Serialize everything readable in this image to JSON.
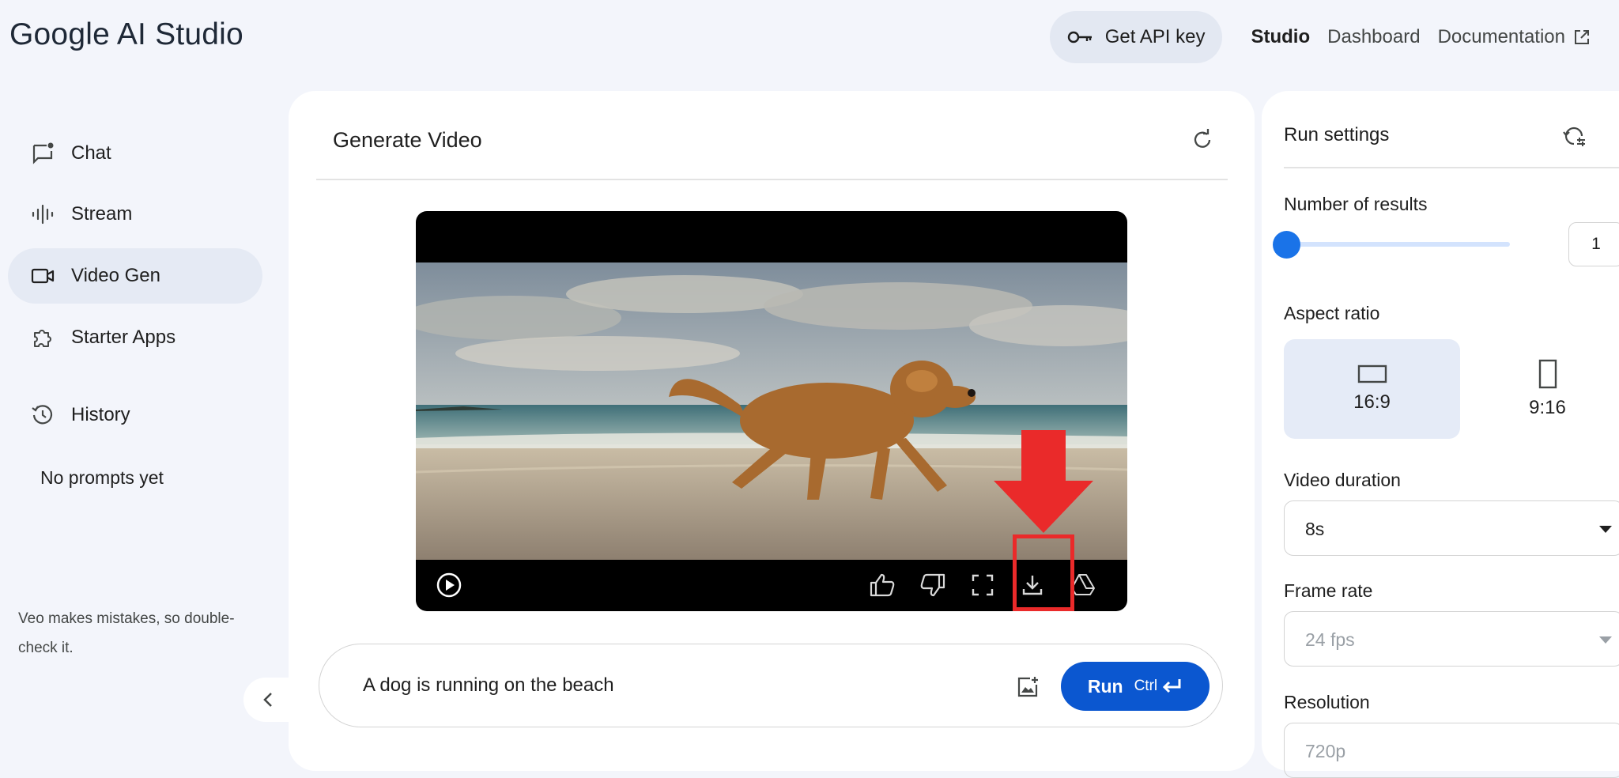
{
  "app": {
    "title": "Google AI Studio"
  },
  "header": {
    "api_key_label": "Get API key",
    "nav": {
      "studio": "Studio",
      "dashboard": "Dashboard",
      "documentation": "Documentation"
    }
  },
  "sidebar": {
    "items": [
      {
        "label": "Chat",
        "icon": "chat-icon"
      },
      {
        "label": "Stream",
        "icon": "stream-icon"
      },
      {
        "label": "Video Gen",
        "icon": "video-icon",
        "active": true
      },
      {
        "label": "Starter Apps",
        "icon": "puzzle-icon"
      },
      {
        "label": "History",
        "icon": "history-icon"
      }
    ],
    "empty_history": "No prompts yet",
    "disclaimer": "Veo makes mistakes, so double-check it."
  },
  "main": {
    "title": "Generate Video",
    "prompt": {
      "value": "A dog is running on the beach"
    },
    "run": {
      "label": "Run",
      "shortcut": "Ctrl"
    }
  },
  "settings": {
    "title": "Run settings",
    "results": {
      "label": "Number of results",
      "value": "1"
    },
    "aspect": {
      "label": "Aspect ratio",
      "options": [
        "16:9",
        "9:16"
      ],
      "selected": "16:9"
    },
    "duration": {
      "label": "Video duration",
      "value": "8s"
    },
    "frame_rate": {
      "label": "Frame rate",
      "value": "24 fps"
    },
    "resolution": {
      "label": "Resolution",
      "value": "720p"
    }
  },
  "colors": {
    "accent": "#0b57d0",
    "slider": "#1a73e8",
    "annotation": "#ea2a2a",
    "active_bg": "#e5eaf4"
  }
}
